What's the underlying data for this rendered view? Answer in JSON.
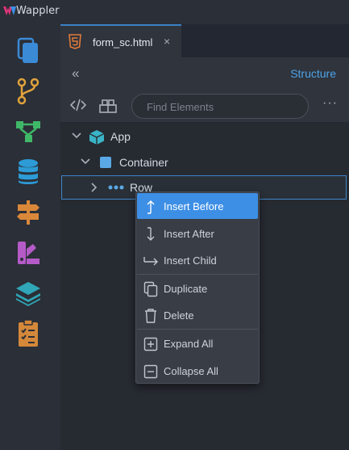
{
  "app": {
    "name": "Wappler"
  },
  "colors": {
    "accent": "#3d8fe6",
    "link": "#4fa3e8",
    "html5": "#e07a3a",
    "app_icon": "#3bb4c8",
    "container_icon": "#5aa9e6"
  },
  "activity_bar": {
    "items": [
      {
        "name": "pages-icon"
      },
      {
        "name": "git-icon"
      },
      {
        "name": "workflows-icon"
      },
      {
        "name": "database-icon"
      },
      {
        "name": "routing-icon"
      },
      {
        "name": "design-icon"
      },
      {
        "name": "layers-icon"
      },
      {
        "name": "tasks-icon"
      }
    ]
  },
  "tab": {
    "label": "form_sc.html",
    "close": "×",
    "icon": "html5-icon"
  },
  "subbar": {
    "collapse_glyph": "«",
    "structure_label": "Structure"
  },
  "toolbar": {
    "search_placeholder": "Find Elements",
    "more_glyph": "···"
  },
  "tree": {
    "nodes": [
      {
        "label": "App",
        "icon": "app-cube-icon"
      },
      {
        "label": "Container",
        "icon": "container-square-icon"
      },
      {
        "label": "Row",
        "icon": "row-dots-icon"
      }
    ]
  },
  "context_menu": {
    "items": [
      {
        "label": "Insert Before",
        "icon": "insert-before-icon"
      },
      {
        "label": "Insert After",
        "icon": "insert-after-icon"
      },
      {
        "label": "Insert Child",
        "icon": "insert-child-icon"
      },
      {
        "label": "Duplicate",
        "icon": "duplicate-icon"
      },
      {
        "label": "Delete",
        "icon": "trash-icon"
      },
      {
        "label": "Expand All",
        "icon": "expand-all-icon"
      },
      {
        "label": "Collapse All",
        "icon": "collapse-all-icon"
      }
    ]
  }
}
